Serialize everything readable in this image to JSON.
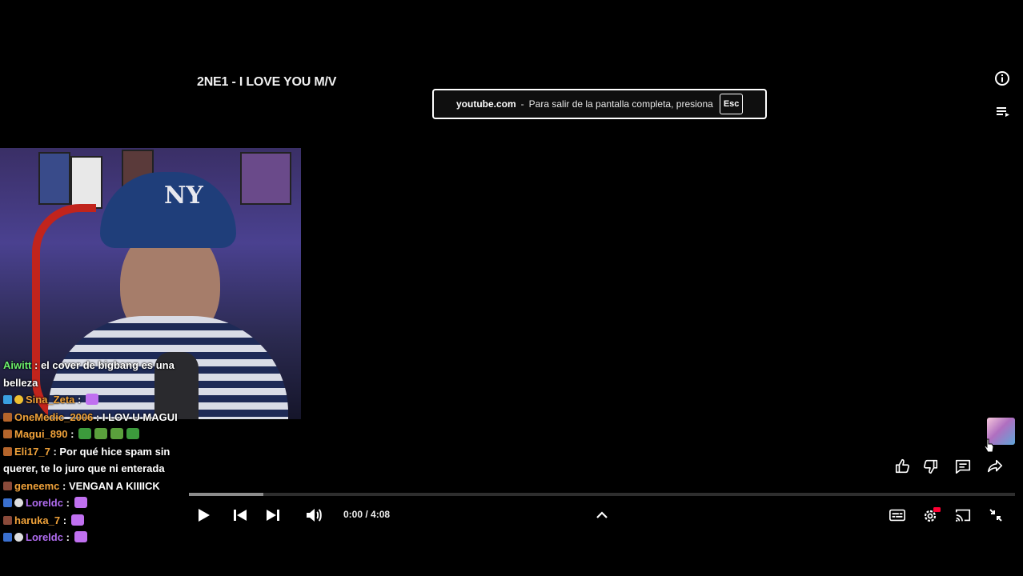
{
  "video": {
    "title": "2NE1 - I LOVE YOU M/V",
    "progress_fraction": 0.0,
    "buffered_fraction": 0.09
  },
  "fullscreen_toast": {
    "domain": "youtube.com",
    "separator": "-",
    "message": "Para salir de la pantalla completa, presiona",
    "key": "Esc"
  },
  "webcam": {
    "cap_logo": "NY"
  },
  "chat": {
    "messages": [
      {
        "user": "Aiwitt",
        "sep": " : ",
        "text": "el cover de bigbang es una belleza",
        "user_color": "#6cf06c"
      },
      {
        "user": "Sina_Zeta",
        "sep": " : ",
        "text": "",
        "user_color": "#f0a23a"
      },
      {
        "user": "OneMedic_2006",
        "sep": " : ",
        "text": "I LOV U MAGUI",
        "user_color": "#f0a23a"
      },
      {
        "user": "Magui_890",
        "sep": " : ",
        "text": "",
        "user_color": "#f0a23a"
      },
      {
        "user": "Eli17_7",
        "sep": " : ",
        "text": "Por qué hice spam sin querer, te lo juro que ni enterada",
        "user_color": "#f0a23a"
      },
      {
        "user": "geneemc",
        "sep": " : ",
        "text": "VENGAN A KIIIICK",
        "user_color": "#f0a23a"
      },
      {
        "user": "Loreldc",
        "sep": " : ",
        "text": "",
        "user_color": "#b06cf0"
      },
      {
        "user": "haruka_7",
        "sep": " : ",
        "text": "",
        "user_color": "#f0a23a"
      },
      {
        "user": "Loreldc",
        "sep": " : ",
        "text": "",
        "user_color": "#b06cf0"
      }
    ]
  },
  "player": {
    "time": "0:00 / 4:08"
  },
  "colors": {
    "background": "#000000",
    "accent_red": "#ff0033",
    "toast_border": "#ffffff"
  },
  "icons": {
    "info": "info-icon",
    "queue": "playlist-queue-icon",
    "play": "play-icon",
    "prev": "skip-previous-icon",
    "next": "skip-next-icon",
    "volume": "volume-icon",
    "chevron": "chevron-up-icon",
    "subtitles": "subtitles-icon",
    "settings": "settings-gear-icon",
    "cast": "cast-icon",
    "exit_fullscreen": "exit-fullscreen-icon",
    "like": "thumbs-up-icon",
    "dislike": "thumbs-down-icon",
    "comments": "comment-icon",
    "share": "share-icon"
  }
}
